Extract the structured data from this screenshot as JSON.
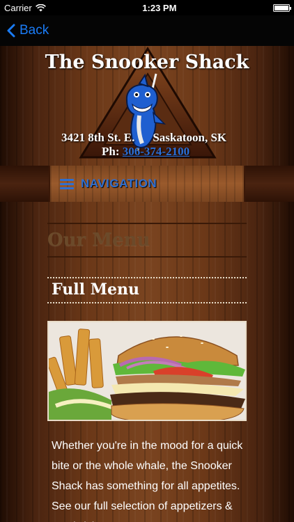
{
  "status_bar": {
    "carrier": "Carrier",
    "time": "1:23 PM",
    "battery_level": 1.0
  },
  "nav_bar": {
    "back_label": "Back"
  },
  "header": {
    "title": "The Snooker Shack",
    "address_street": "3421 8th St. E.",
    "address_city": "Saskatoon, SK",
    "phone_label": "Ph:",
    "phone_number": "306-374-2100"
  },
  "navigation": {
    "label": "NAVIGATION"
  },
  "page": {
    "heading": "Our Menu",
    "section_title": "Full Menu",
    "description": "Whether you're in the mood for a quick bite or the whole whale, the Snooker Shack has something for all appetites. See our full selection of appetizers & sandwiches"
  },
  "colors": {
    "accent_blue": "#2f6fd0",
    "ios_blue": "#1a7cf6",
    "wood_dark": "#4a2410"
  }
}
